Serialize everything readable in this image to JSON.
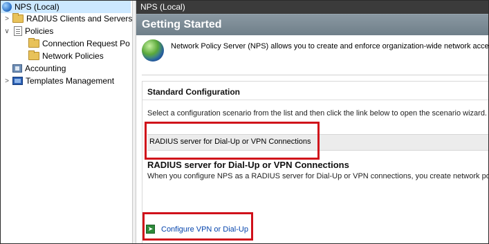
{
  "tree": {
    "root": "NPS (Local)",
    "items": [
      {
        "label": "RADIUS Clients and Servers"
      },
      {
        "label": "Policies"
      },
      {
        "label": "Connection Request Po"
      },
      {
        "label": "Network Policies"
      },
      {
        "label": "Accounting"
      },
      {
        "label": "Templates Management"
      }
    ]
  },
  "content": {
    "header": "NPS (Local)",
    "banner": "Getting Started",
    "intro": "Network Policy Server (NPS) allows you to create and enforce organization-wide network access p",
    "standard": {
      "title": "Standard Configuration",
      "description": "Select a configuration scenario from the list and then click the link below to open the scenario wizard.",
      "selected": "RADIUS server for Dial-Up or VPN Connections",
      "scenario_title": "RADIUS server for Dial-Up or VPN Connections",
      "scenario_desc": "When you configure NPS as a RADIUS server for Dial-Up or VPN connections, you create network polic",
      "link": "Configure VPN or Dial-Up"
    }
  },
  "colors": {
    "highlight": "#d0101a",
    "header_bg": "#3b3b3b",
    "banner_bg": "#7f8f99",
    "link": "#0645ad"
  }
}
